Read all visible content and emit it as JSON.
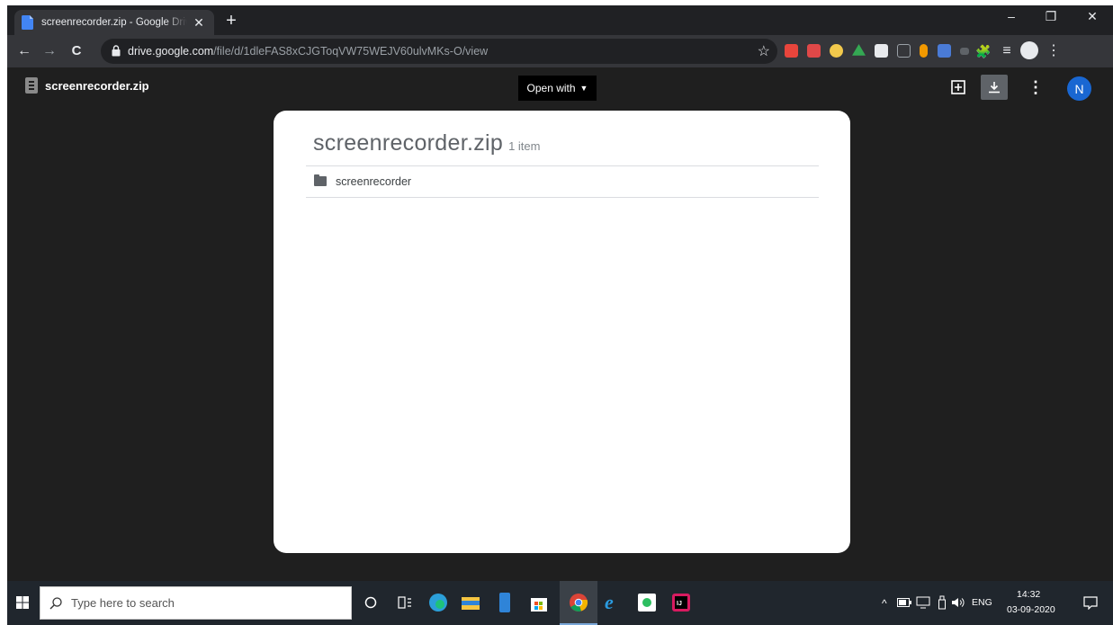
{
  "browser": {
    "tab": {
      "title": "screenrecorder.zip - Google Drive",
      "close_label": "✕"
    },
    "new_tab_label": "+",
    "window_controls": {
      "minimize": "–",
      "restore": "❐",
      "close": "✕"
    },
    "nav": {
      "back": "←",
      "forward": "→",
      "reload": "C"
    },
    "address": {
      "domain": "drive.google.com",
      "path": "/file/d/1dleFAS8xCJGToqVW75WEJV60ulvMKs-O/view"
    },
    "bookmark_star": "☆",
    "extensions": [
      {
        "name": "ext-red-badge",
        "color": "#e8453c"
      },
      {
        "name": "ext-red-square",
        "color": "#e04848"
      },
      {
        "name": "ext-yellow-compass",
        "color": "#f2c94c"
      },
      {
        "name": "ext-drive",
        "color": "#34a853"
      },
      {
        "name": "ext-t-square",
        "color": "#e8eaed"
      },
      {
        "name": "ext-cb",
        "color": "#9aa0a6"
      },
      {
        "name": "ext-orange-pill",
        "color": "#f29900"
      },
      {
        "name": "ext-blue-square",
        "color": "#4a7bd6"
      },
      {
        "name": "ext-xr",
        "color": "#5f6368"
      }
    ],
    "extras": {
      "puzzle": "🧩",
      "queue": "≡",
      "menu": "⋮"
    }
  },
  "viewer": {
    "file_name": "screenrecorder.zip",
    "open_with_label": "Open with",
    "caret": "▼",
    "add_shortcut_icon": "⊞",
    "download_icon": "⤓",
    "more_icon": "⋮",
    "avatar_initial": "N",
    "card": {
      "title": "screenrecorder.zip",
      "item_count": "1 item",
      "items": [
        {
          "label": "screenrecorder",
          "type": "folder"
        }
      ]
    }
  },
  "taskbar": {
    "search_placeholder": "Type here to search",
    "language": "ENG",
    "time": "14:32",
    "date": "03-09-2020",
    "tray_chevron": "^",
    "notification_icon": "🗨"
  }
}
